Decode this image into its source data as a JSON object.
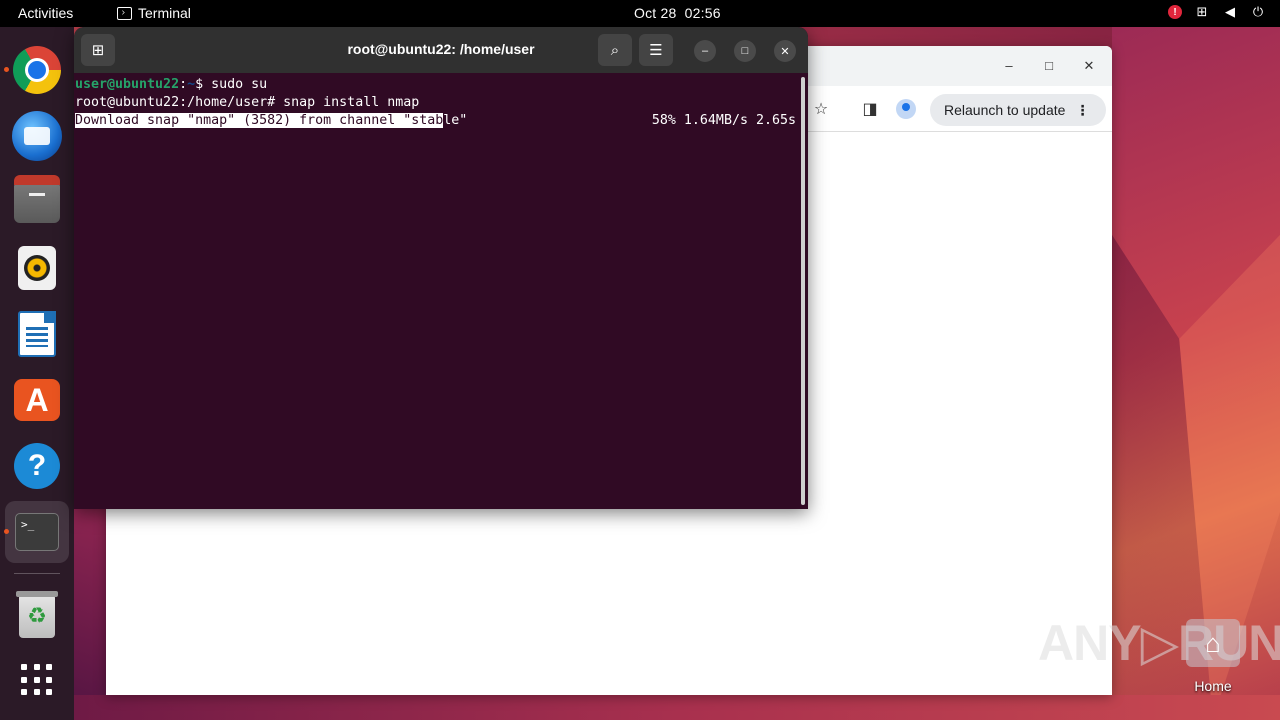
{
  "topbar": {
    "activities": "Activities",
    "app_name": "Terminal",
    "date": "Oct 28",
    "time": "02:56",
    "alert_badge": "!"
  },
  "dock": {
    "items": [
      {
        "name": "Google Chrome",
        "icon": "chrome-icon"
      },
      {
        "name": "Thunderbird Mail",
        "icon": "thunderbird-icon"
      },
      {
        "name": "Files",
        "icon": "files-icon"
      },
      {
        "name": "Rhythmbox",
        "icon": "rhythmbox-icon"
      },
      {
        "name": "LibreOffice Writer",
        "icon": "writer-icon"
      },
      {
        "name": "Ubuntu Software",
        "icon": "app-store-icon"
      },
      {
        "name": "Help",
        "icon": "help-icon"
      },
      {
        "name": "Terminal",
        "icon": "terminal-icon"
      },
      {
        "name": "Trash",
        "icon": "trash-icon"
      },
      {
        "name": "Show Applications",
        "icon": "app-grid-icon"
      }
    ],
    "appstore_glyph": "A",
    "help_glyph": "?",
    "terminal_glyph": ">_",
    "trash_glyph": "♻"
  },
  "browser": {
    "relaunch_label": "Relaunch to update",
    "menu_glyph": "⋮"
  },
  "terminal": {
    "title": "root@ubuntu22: /home/user",
    "lines": {
      "l1_user": "user@ubuntu22",
      "l1_sep": ":",
      "l1_path": "~",
      "l1_cmd": "$ sudo su",
      "l2": "root@ubuntu22:/home/user# snap install nmap",
      "l3_selected": "Download snap \"nmap\" (3582) from channel \"stab",
      "l3_rest": "le\"",
      "progress": "58% 1.64MB/s 2.65s"
    }
  },
  "desktop": {
    "home_label": "Home",
    "watermark": "ANY▷RUN"
  },
  "colors": {
    "terminal_bg": "#300a24",
    "prompt_user": "#26a269",
    "accent": "#e95420"
  }
}
